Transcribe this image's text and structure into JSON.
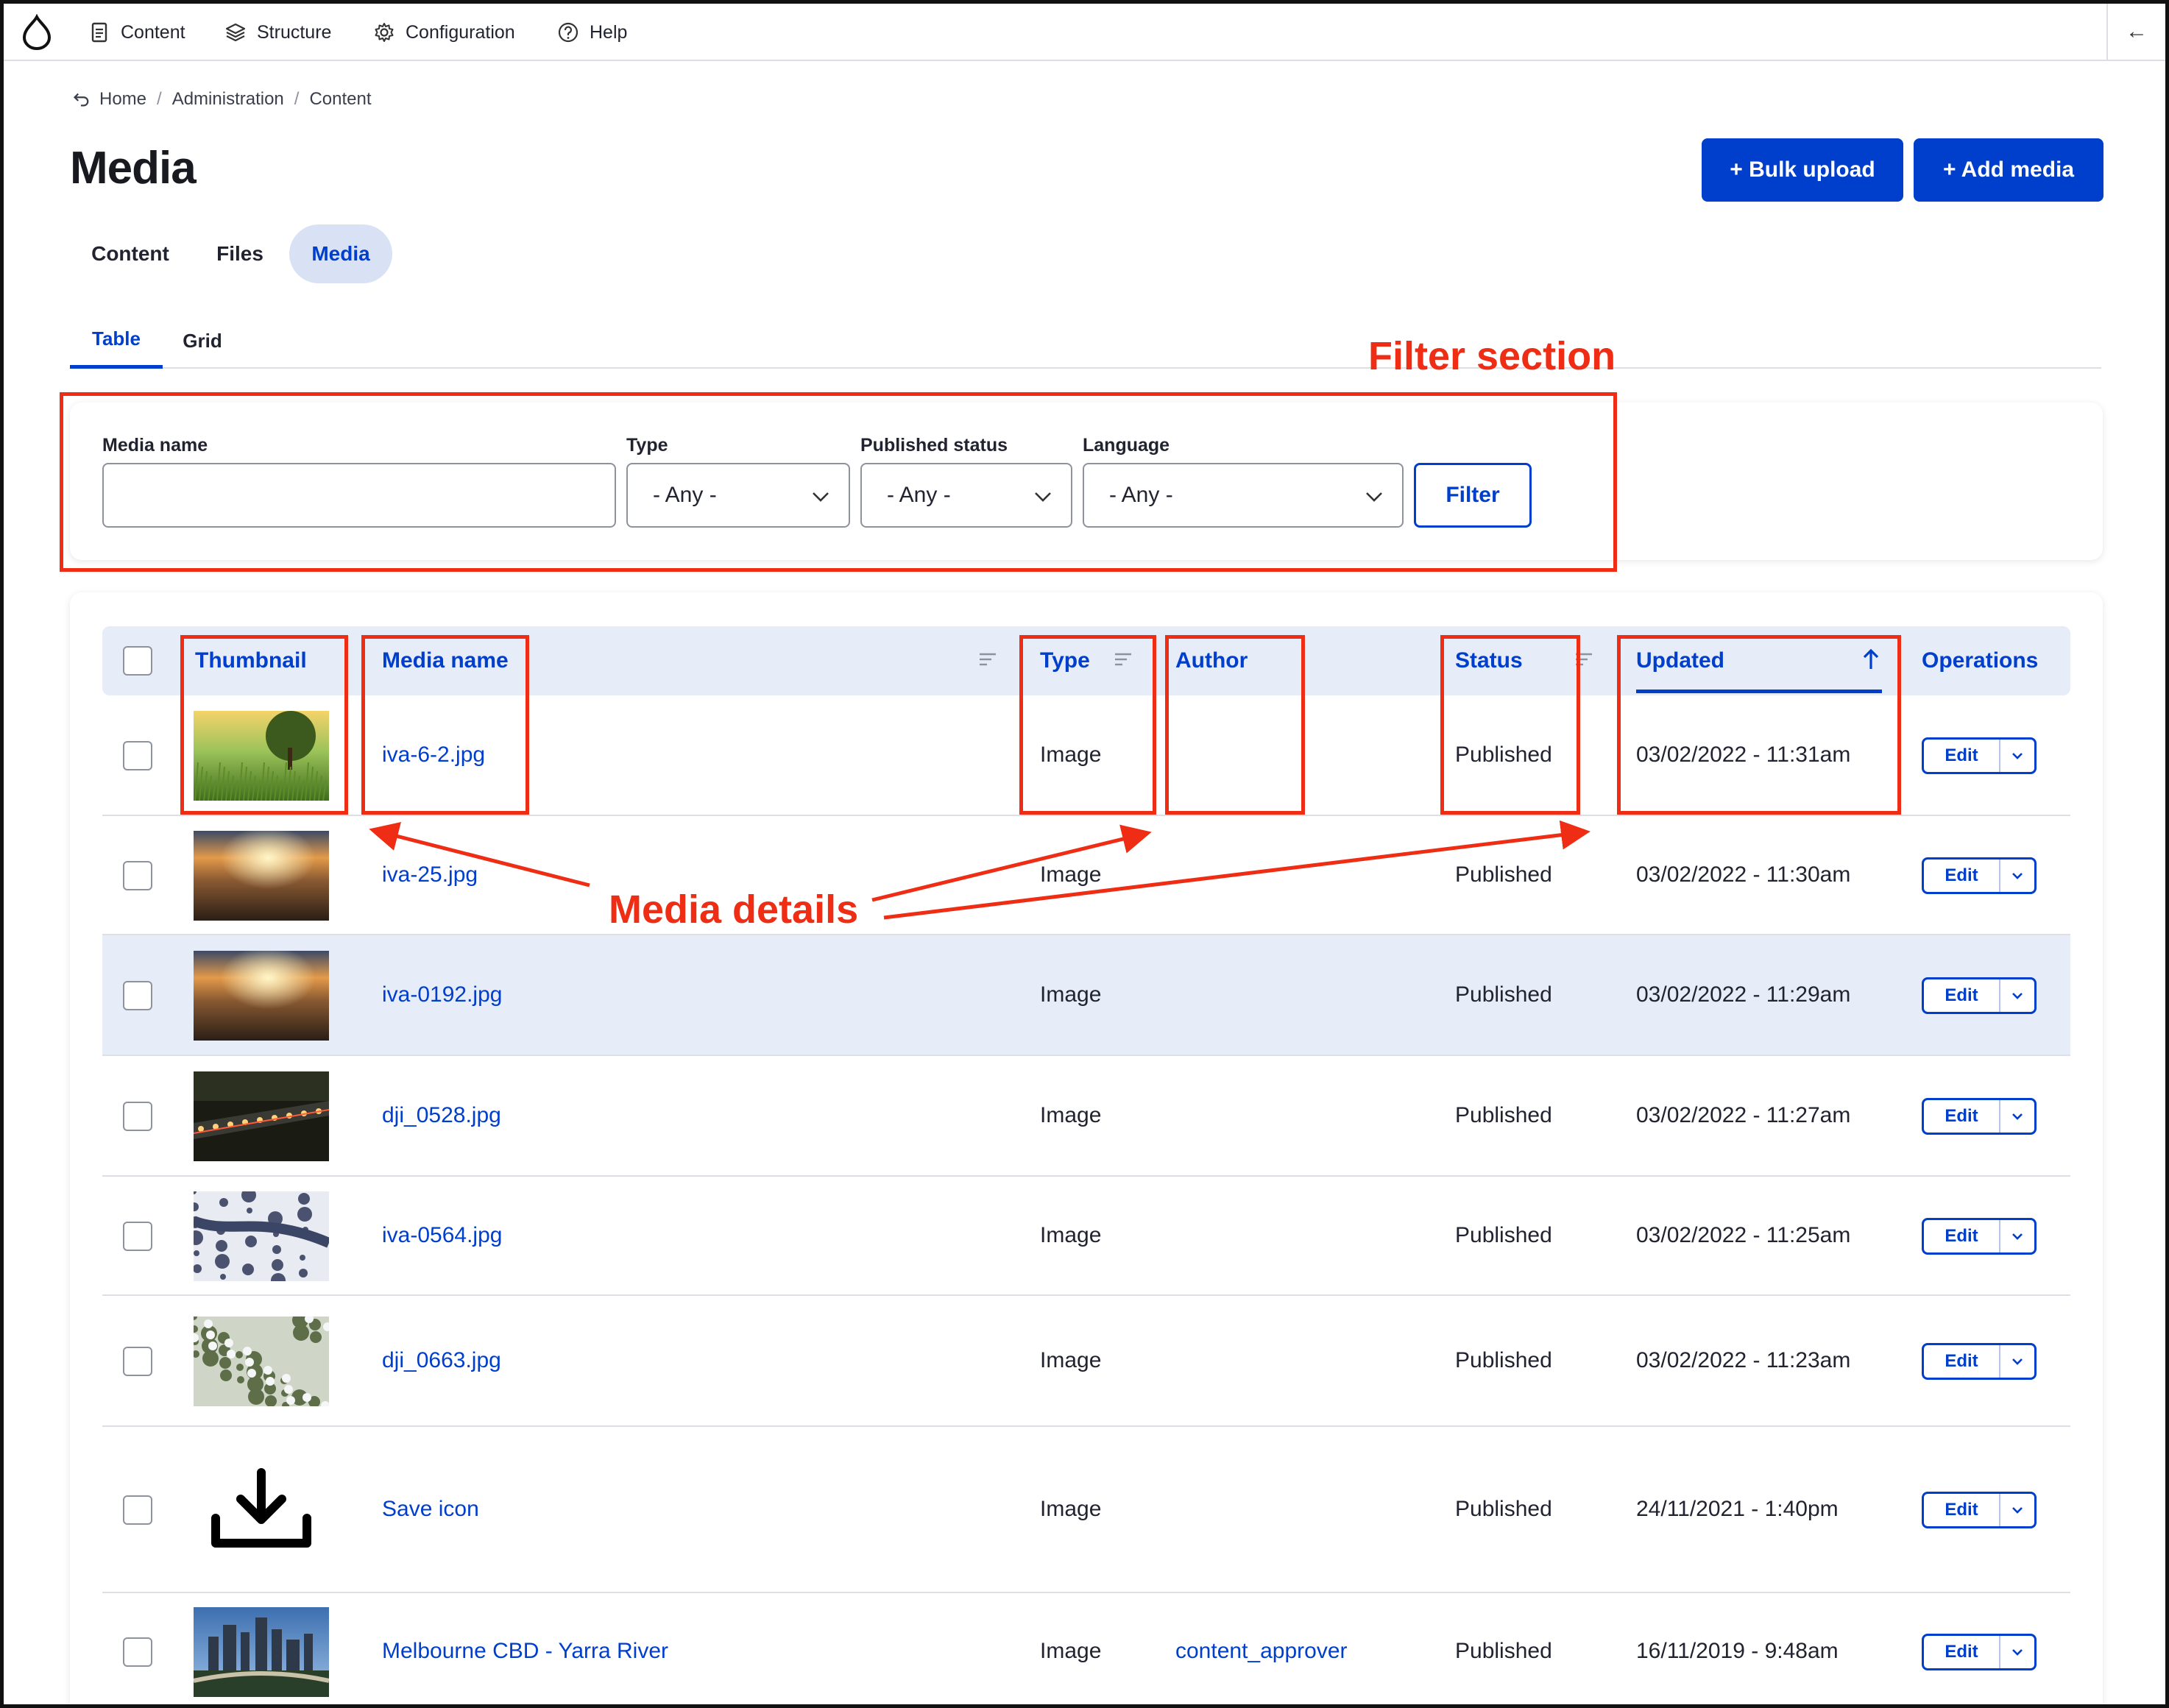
{
  "toolbar": {
    "items": [
      {
        "label": "Content",
        "icon": "document-icon"
      },
      {
        "label": "Structure",
        "icon": "layers-icon"
      },
      {
        "label": "Configuration",
        "icon": "gear-icon"
      },
      {
        "label": "Help",
        "icon": "question-circle-icon"
      }
    ],
    "back_icon": "←"
  },
  "breadcrumb": [
    "Home",
    "Administration",
    "Content"
  ],
  "breadcrumb_sep": "/",
  "page": {
    "title": "Media",
    "bulk_upload_label": "+ Bulk upload",
    "add_media_label": "+ Add media"
  },
  "primary_tabs": [
    {
      "label": "Content",
      "active": false
    },
    {
      "label": "Files",
      "active": false
    },
    {
      "label": "Media",
      "active": true
    }
  ],
  "secondary_tabs": [
    {
      "label": "Table",
      "active": true
    },
    {
      "label": "Grid",
      "active": false
    }
  ],
  "filters": {
    "media_name": {
      "label": "Media name",
      "value": ""
    },
    "type": {
      "label": "Type",
      "value": "- Any -"
    },
    "published_status": {
      "label": "Published status",
      "value": "- Any -"
    },
    "language": {
      "label": "Language",
      "value": "- Any -"
    },
    "submit_label": "Filter"
  },
  "table": {
    "columns": {
      "thumbnail": "Thumbnail",
      "media_name": "Media name",
      "type": "Type",
      "author": "Author",
      "status": "Status",
      "updated": "Updated",
      "operations": "Operations"
    },
    "sort": {
      "column": "Updated",
      "direction": "ascending",
      "icon": "arrow-up-icon"
    },
    "edit_label": "Edit",
    "rows": [
      {
        "name": "iva-6-2.jpg",
        "type": "Image",
        "author": "",
        "status": "Published",
        "updated": "03/02/2022 - 11:31am",
        "thumb": "wheat-field-sunset",
        "highlighted": false
      },
      {
        "name": "iva-25.jpg",
        "type": "Image",
        "author": "",
        "status": "Published",
        "updated": "03/02/2022 - 11:30am",
        "thumb": "aerial-sunrise",
        "highlighted": false
      },
      {
        "name": "iva-0192.jpg",
        "type": "Image",
        "author": "",
        "status": "Published",
        "updated": "03/02/2022 - 11:29am",
        "thumb": "aerial-sunrise",
        "highlighted": true
      },
      {
        "name": "dji_0528.jpg",
        "type": "Image",
        "author": "",
        "status": "Published",
        "updated": "03/02/2022 - 11:27am",
        "thumb": "night-road-lights",
        "highlighted": false
      },
      {
        "name": "iva-0564.jpg",
        "type": "Image",
        "author": "",
        "status": "Published",
        "updated": "03/02/2022 - 11:25am",
        "thumb": "snowy-river",
        "highlighted": false
      },
      {
        "name": "dji_0663.jpg",
        "type": "Image",
        "author": "",
        "status": "Published",
        "updated": "03/02/2022 - 11:23am",
        "thumb": "snowy-forest",
        "highlighted": false
      },
      {
        "name": "Save icon",
        "type": "Image",
        "author": "",
        "status": "Published",
        "updated": "24/11/2021 - 1:40pm",
        "thumb": "download-icon",
        "highlighted": false
      },
      {
        "name": "Melbourne CBD - Yarra River",
        "type": "Image",
        "author": "content_approver",
        "status": "Published",
        "updated": "16/11/2019 - 9:48am",
        "thumb": "city-skyline",
        "highlighted": false
      }
    ]
  },
  "annotations": {
    "filter_section": "Filter section",
    "media_details": "Media details",
    "color": "#ee2d14"
  },
  "colors": {
    "accent": "#003ecc",
    "header_bg": "#e6ecf8",
    "annotation": "#ee2d14"
  }
}
